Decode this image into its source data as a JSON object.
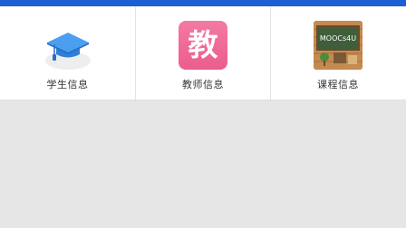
{
  "header": {
    "accent_color": "#1a5fd6"
  },
  "menu": {
    "items": [
      {
        "label": "学生信息",
        "icon": "graduation-cap-icon"
      },
      {
        "label": "教师信息",
        "icon": "teacher-icon",
        "icon_text": "教",
        "icon_color": "#ec5d8c"
      },
      {
        "label": "课程信息",
        "icon": "chalkboard-icon",
        "icon_text": "MOOCs4U"
      }
    ]
  }
}
